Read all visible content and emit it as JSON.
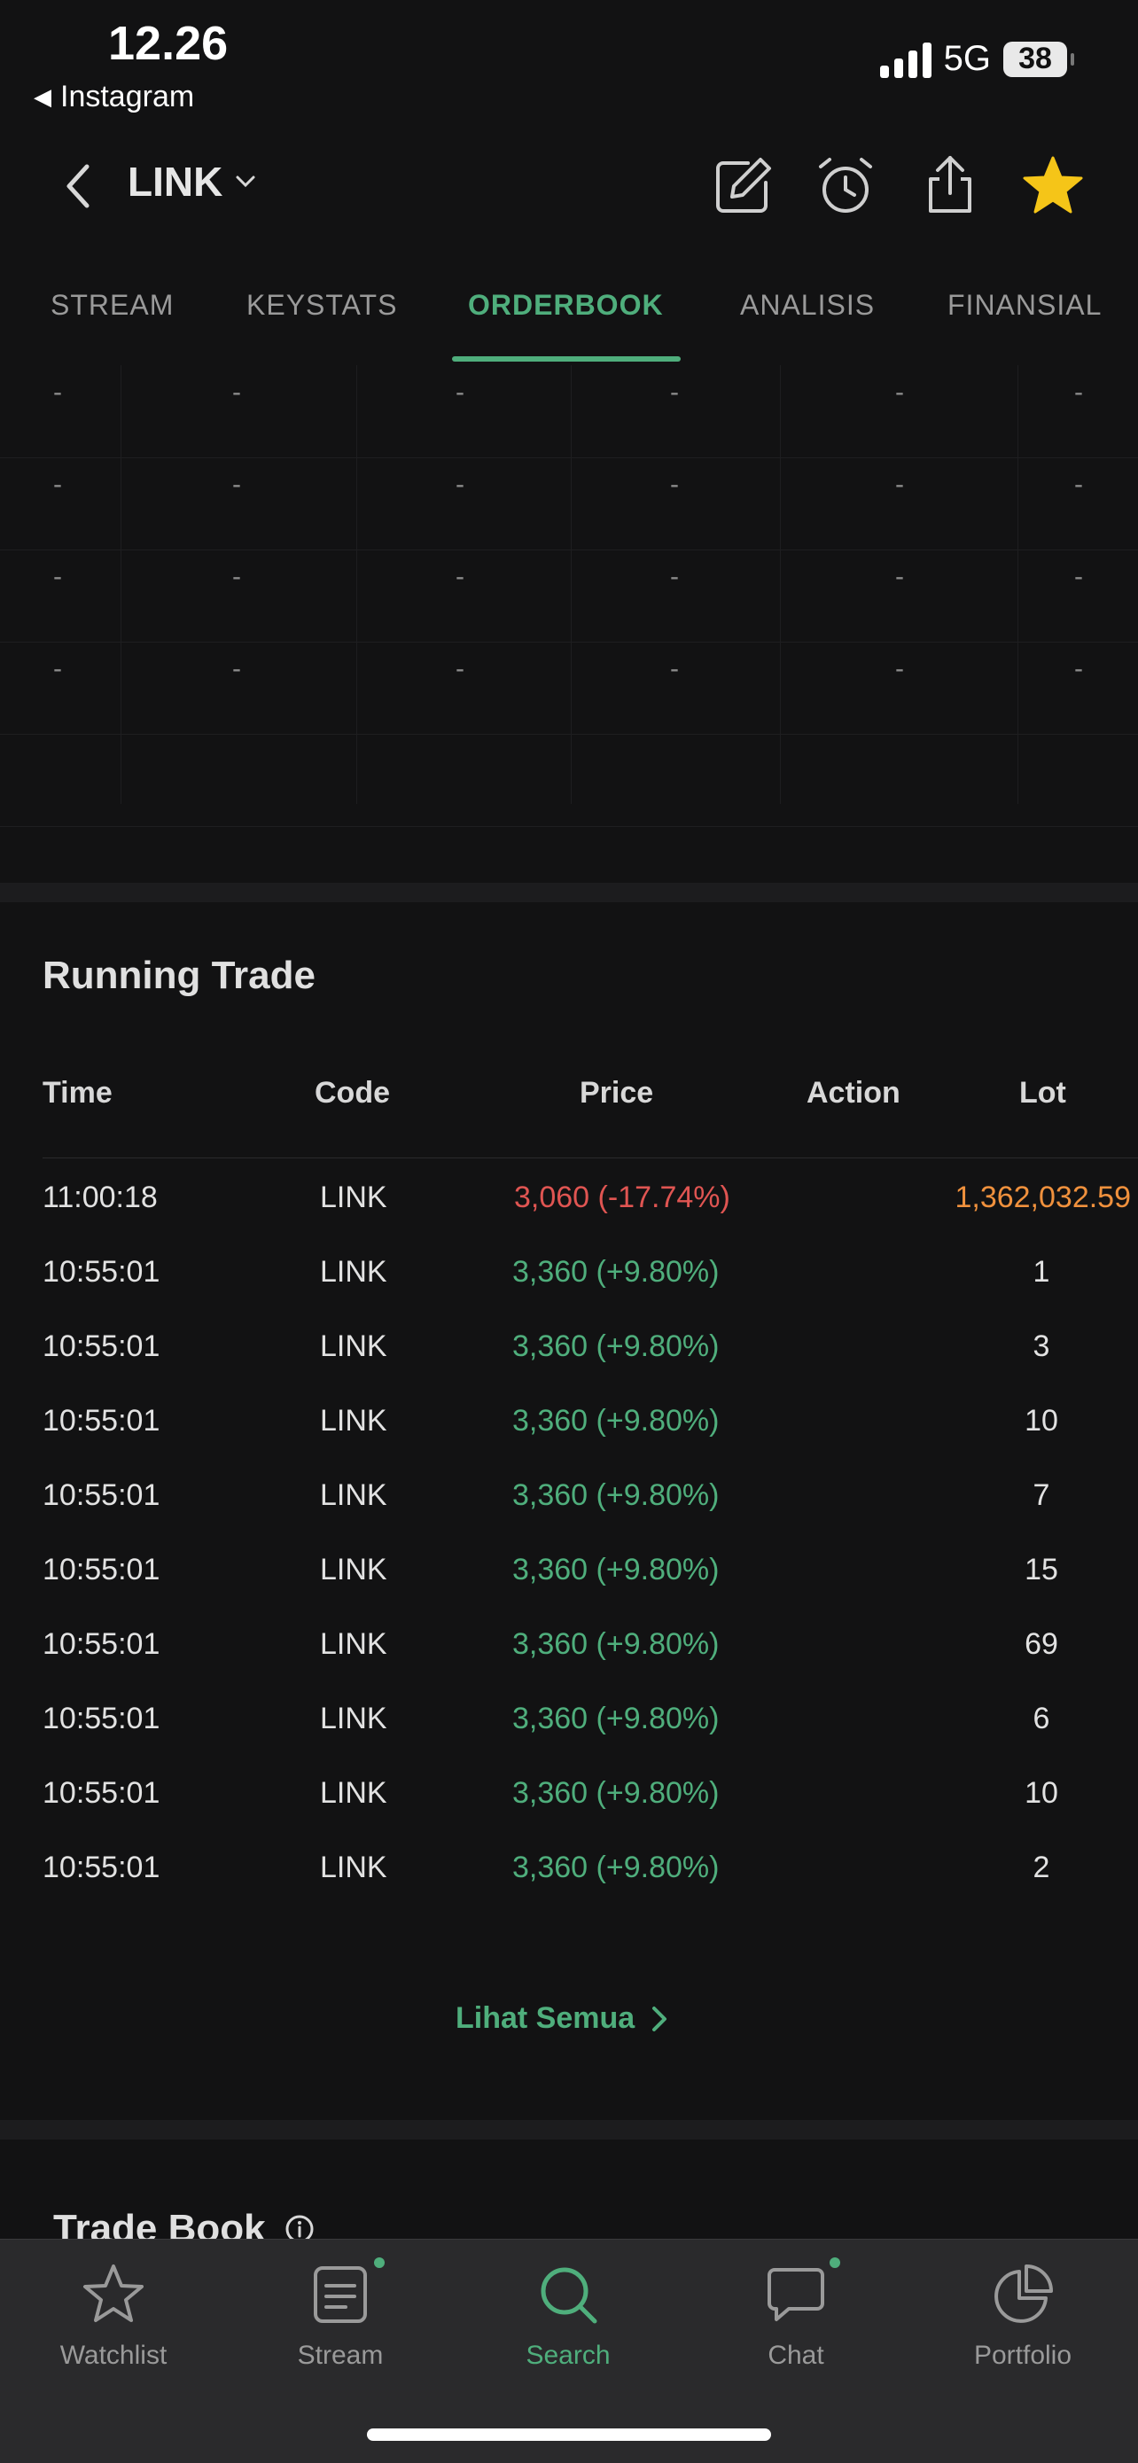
{
  "status_bar": {
    "time": "12.26",
    "back_app": "Instagram",
    "network": "5G",
    "battery": "38"
  },
  "header": {
    "ticker": "LINK"
  },
  "tabs": [
    {
      "label": "STREAM"
    },
    {
      "label": "KEYSTATS"
    },
    {
      "label": "ORDERBOOK"
    },
    {
      "label": "ANALISIS"
    },
    {
      "label": "FINANSIAL"
    }
  ],
  "active_tab": "ORDERBOOK",
  "orderbook": {
    "placeholder": "-"
  },
  "running_trade": {
    "title": "Running Trade",
    "columns": [
      "Time",
      "Code",
      "Price",
      "Action",
      "Lot"
    ],
    "rows": [
      {
        "time": "11:00:18",
        "code": "LINK",
        "price": "3,060 (-17.74%)",
        "action": "",
        "lot": "1,362,032.59"
      },
      {
        "time": "10:55:01",
        "code": "LINK",
        "price": "3,360 (+9.80%)",
        "action": "",
        "lot": "1"
      },
      {
        "time": "10:55:01",
        "code": "LINK",
        "price": "3,360 (+9.80%)",
        "action": "",
        "lot": "3"
      },
      {
        "time": "10:55:01",
        "code": "LINK",
        "price": "3,360 (+9.80%)",
        "action": "",
        "lot": "10"
      },
      {
        "time": "10:55:01",
        "code": "LINK",
        "price": "3,360 (+9.80%)",
        "action": "",
        "lot": "7"
      },
      {
        "time": "10:55:01",
        "code": "LINK",
        "price": "3,360 (+9.80%)",
        "action": "",
        "lot": "15"
      },
      {
        "time": "10:55:01",
        "code": "LINK",
        "price": "3,360 (+9.80%)",
        "action": "",
        "lot": "69"
      },
      {
        "time": "10:55:01",
        "code": "LINK",
        "price": "3,360 (+9.80%)",
        "action": "",
        "lot": "6"
      },
      {
        "time": "10:55:01",
        "code": "LINK",
        "price": "3,360 (+9.80%)",
        "action": "",
        "lot": "10"
      },
      {
        "time": "10:55:01",
        "code": "LINK",
        "price": "3,360 (+9.80%)",
        "action": "",
        "lot": "2"
      }
    ],
    "see_all": "Lihat Semua"
  },
  "trade_book": {
    "title": "Trade Book"
  },
  "bottom_nav": [
    {
      "label": "Watchlist",
      "icon": "star-icon"
    },
    {
      "label": "Stream",
      "icon": "stream-icon"
    },
    {
      "label": "Search",
      "icon": "search-icon"
    },
    {
      "label": "Chat",
      "icon": "chat-icon"
    },
    {
      "label": "Portfolio",
      "icon": "pie-chart-icon"
    }
  ],
  "colors": {
    "accent": "#4fae7c",
    "negative": "#e05552",
    "highlight": "#f0913d",
    "favorite": "#f5c518"
  }
}
